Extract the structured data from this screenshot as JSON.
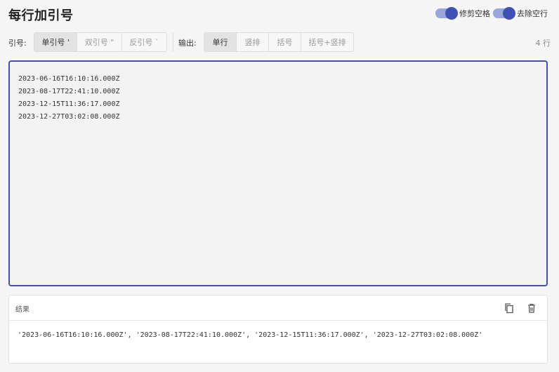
{
  "page": {
    "title": "每行加引号"
  },
  "toggles": [
    {
      "label": "修剪空格",
      "on": true
    },
    {
      "label": "去除空行",
      "on": true
    }
  ],
  "quote": {
    "label": "引号:",
    "options": [
      "单引号 '",
      "双引号 \"",
      "反引号 `"
    ],
    "selected": "单引号 '"
  },
  "output": {
    "label": "输出:",
    "options": [
      "单行",
      "竖排",
      "括号",
      "括号+竖排"
    ],
    "selected": "单行"
  },
  "line_count": "4 行",
  "input": {
    "lines": [
      "2023-06-16T16:10:16.000Z",
      "2023-08-17T22:41:10.000Z",
      "2023-12-15T11:36:17.000Z",
      "2023-12-27T03:02:08.000Z"
    ]
  },
  "result": {
    "title": "结果",
    "text": "'2023-06-16T16:10:16.000Z', '2023-08-17T22:41:10.000Z', '2023-12-15T11:36:17.000Z', '2023-12-27T03:02:08.000Z'",
    "copy_icon": "copy-icon",
    "delete_icon": "trash-icon"
  },
  "colors": {
    "accent": "#3f51b5",
    "switch_track": "#9aa5dc"
  }
}
